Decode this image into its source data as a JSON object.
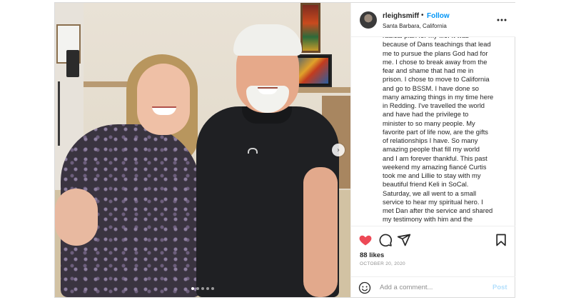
{
  "header": {
    "username": "rleighsmiff",
    "separator": "•",
    "follow_label": "Follow",
    "location": "Santa Barbara, California",
    "more_icon": "more-options-icon"
  },
  "caption": {
    "text": "radical plan for my life. It was\nbecause of Dans teachings that lead\nme to pursue the plans God had for\nme. I chose to break away from the\nfear and shame that had me in\nprison. I chose to move to California\nand go to BSSM. I have done so\nmany amazing things in my time here\nin Redding. I've travelled the world\nand have had the privilege to\nminister to so many people. My\nfavorite part of life now, are the gifts\nof relationships I have. So many\namazing people that fill my world\nand I am forever thankful. This past\nweekend my amazing fiancé Curtis\ntook me and Lillie to stay with my\nbeautiful friend Keli in SoCal.\nSaturday, we all went to a small\nservice to hear my spiritual hero. I\nmet Dan after the service and shared\nmy testimony with him and the"
  },
  "actions": {
    "icons": [
      "heart-icon",
      "comment-icon",
      "share-icon",
      "bookmark-icon"
    ],
    "like_color": "#ed4956",
    "likes": "88 likes",
    "date": "OCTOBER 20, 2020"
  },
  "comment_bar": {
    "placeholder": "Add a comment...",
    "post_label": "Post"
  },
  "carousel": {
    "next_glyph": "›",
    "current_slide": 1,
    "total_slides": 5
  }
}
